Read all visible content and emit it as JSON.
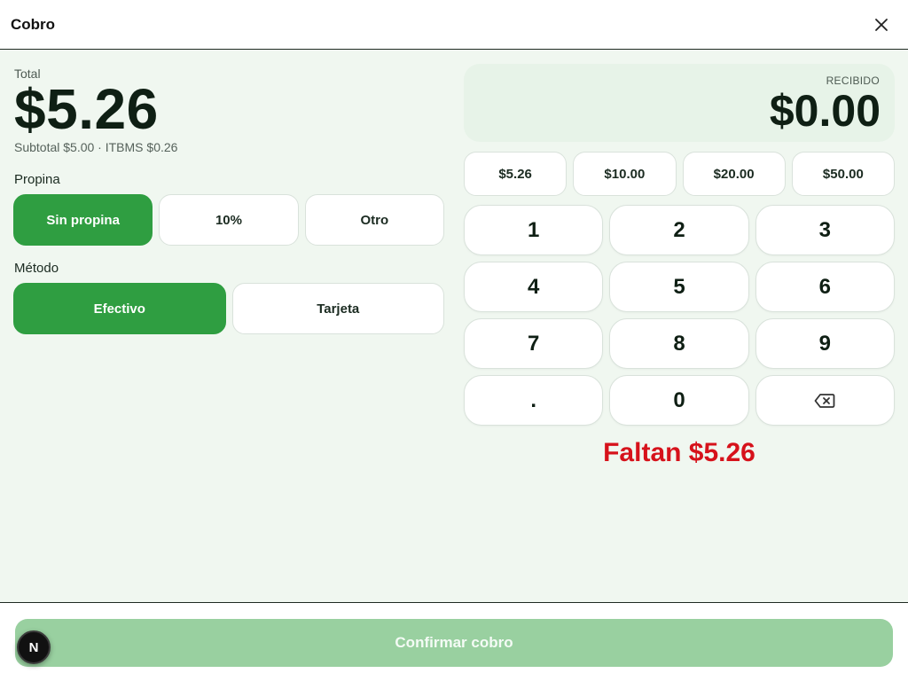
{
  "header": {
    "title": "Cobro",
    "close_icon": "close-icon"
  },
  "summary": {
    "total_label": "Total",
    "total_amount": "$5.26",
    "subtotal_text": "Subtotal $5.00 · ITBMS $0.26"
  },
  "tip": {
    "label": "Propina",
    "options": [
      {
        "label": "Sin propina",
        "selected": true
      },
      {
        "label": "10%",
        "selected": false
      },
      {
        "label": "Otro",
        "selected": false
      }
    ]
  },
  "method": {
    "label": "Método",
    "options": [
      {
        "label": "Efectivo",
        "selected": true
      },
      {
        "label": "Tarjeta",
        "selected": false
      }
    ]
  },
  "received": {
    "label": "RECIBIDO",
    "amount": "$0.00"
  },
  "quick_amounts": [
    "$5.26",
    "$10.00",
    "$20.00",
    "$50.00"
  ],
  "keypad": {
    "keys": [
      "1",
      "2",
      "3",
      "4",
      "5",
      "6",
      "7",
      "8",
      "9",
      ".",
      "0"
    ],
    "backspace_icon": "backspace-icon"
  },
  "status": {
    "missing_text": "Faltan $5.26",
    "color": "#d6121b"
  },
  "footer": {
    "confirm_label": "Confirmar cobro",
    "badge_letter": "N"
  },
  "colors": {
    "accent": "#2f9e41",
    "accent_disabled": "#99d0a0",
    "background": "#f0f7f0"
  }
}
